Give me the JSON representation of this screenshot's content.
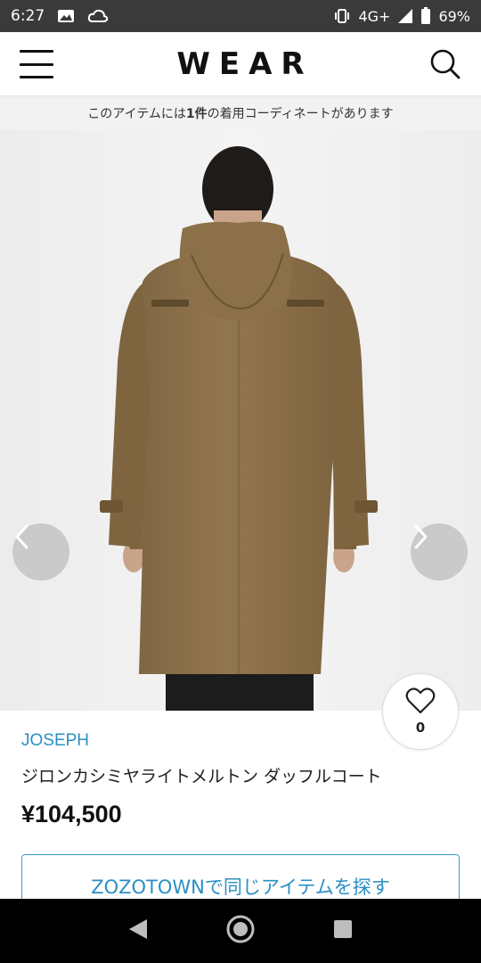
{
  "status_bar": {
    "time": "6:27",
    "network": "4G+",
    "battery": "69%",
    "icons": [
      "image-icon",
      "cloud-icon",
      "vibrate-icon",
      "signal-icon",
      "battery-icon"
    ]
  },
  "header": {
    "logo": "WEAR",
    "menu_icon": "hamburger-menu-icon",
    "search_icon": "search-icon"
  },
  "notice": {
    "prefix": "このアイテムには",
    "count": "1件",
    "suffix": "の着用コーディネートがあります"
  },
  "gallery": {
    "image": "brown-duffle-coat-back-view",
    "prev_icon": "chevron-left-icon",
    "next_icon": "chevron-right-icon"
  },
  "like": {
    "icon": "heart-icon",
    "count": "0"
  },
  "product": {
    "brand": "JOSEPH",
    "name": "ジロンカシミヤライトメルトン ダッフルコート",
    "price": "¥104,500"
  },
  "cta": {
    "label": "ZOZOTOWNで同じアイテムを探す"
  },
  "colors": {
    "accent": "#2a8fc4",
    "coat": "#8a6f45"
  }
}
